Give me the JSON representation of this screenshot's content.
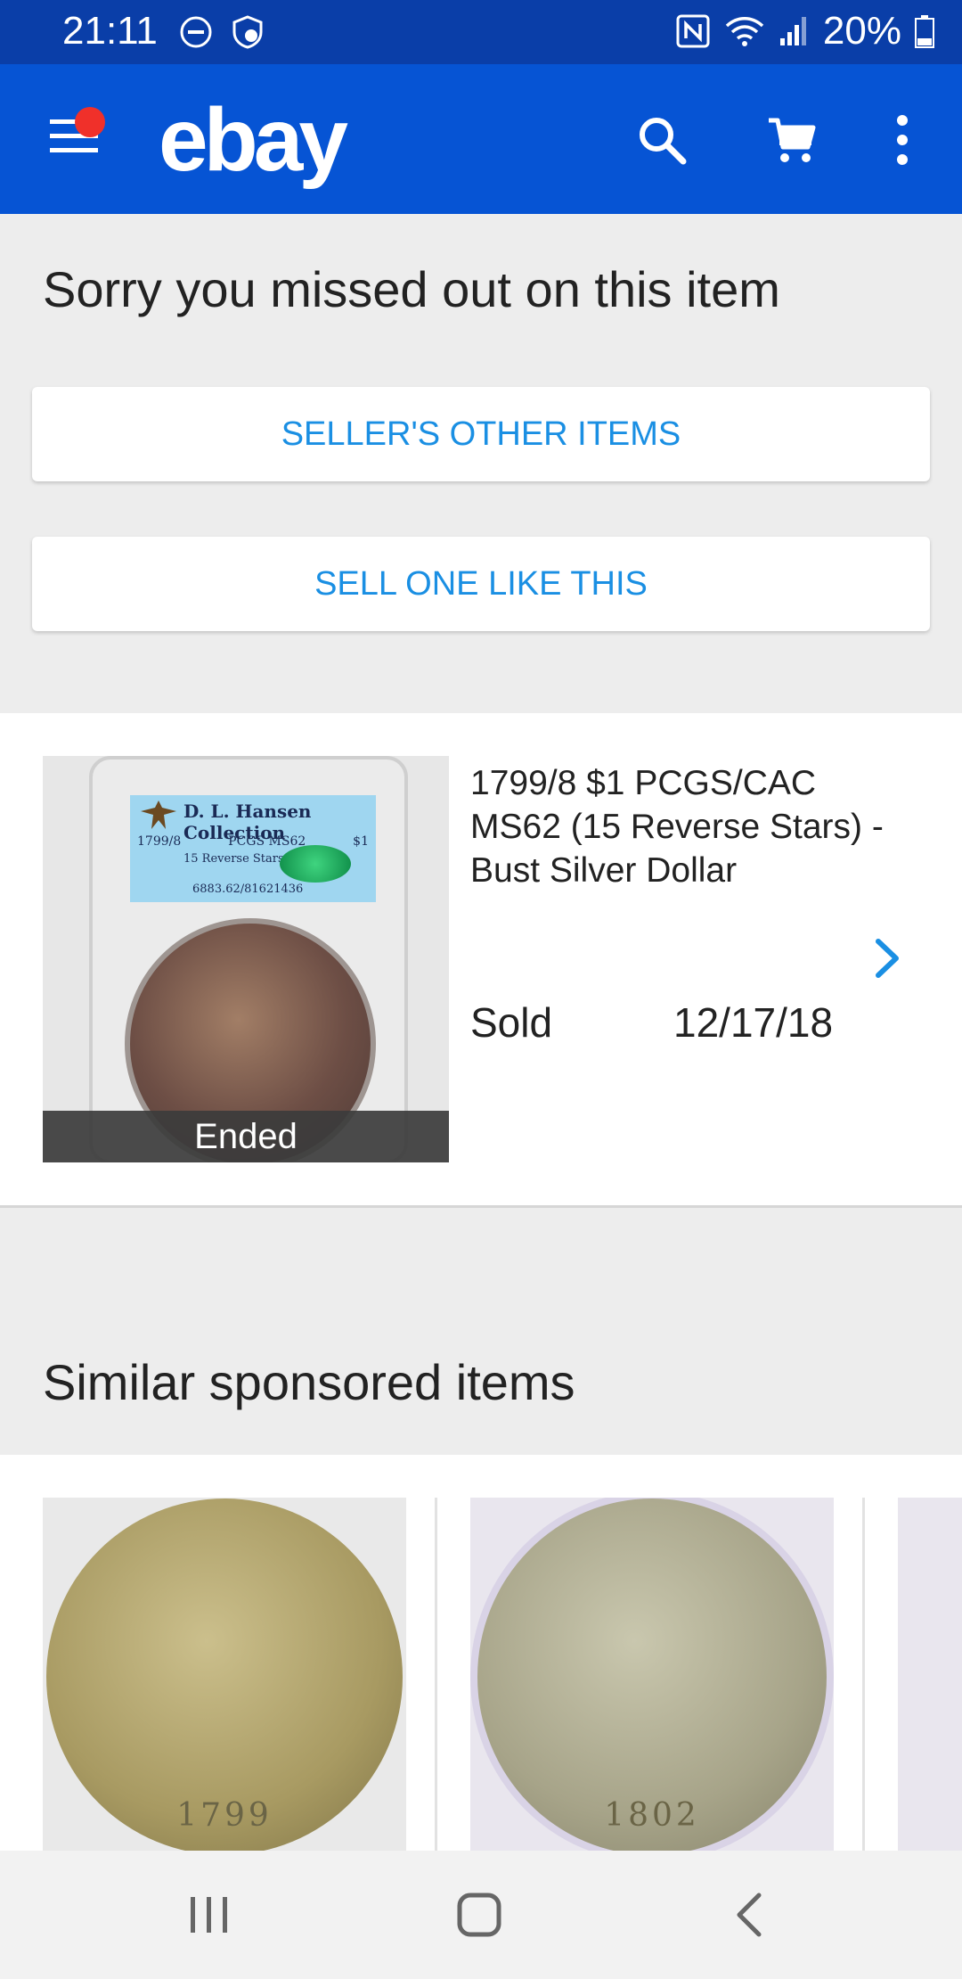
{
  "status_bar": {
    "time": "21:11",
    "battery": "20%"
  },
  "app_bar": {
    "logo": "ebay",
    "icons": [
      "menu-icon",
      "search-icon",
      "cart-icon",
      "more-vert-icon"
    ],
    "color": "#0654d4"
  },
  "missed": {
    "title": "Sorry you missed out on this item",
    "sellers_other_items": "SELLER'S OTHER ITEMS",
    "sell_one_like_this": "SELL ONE LIKE THIS"
  },
  "item": {
    "title": "1799/8 $1 PCGS/CAC MS62 (15 Reverse Stars) - Bust Silver Dollar",
    "status_band": "Ended",
    "sold_label": "Sold",
    "sold_date": "12/17/18",
    "slab_label": {
      "collection": "D. L. Hansen Collection",
      "date": "1799/8",
      "grade": "PCGS MS62",
      "denomination": "$1",
      "variety": "15 Reverse Stars",
      "cert": "6883.62/81621436"
    }
  },
  "similar": {
    "title": "Similar sponsored items",
    "cards": [
      {
        "year": "1799"
      },
      {
        "year": "1802"
      }
    ]
  },
  "colors": {
    "accent_blue": "#1a8fe3",
    "status_bar": "#0a3ea8",
    "notification": "#f0302a"
  }
}
